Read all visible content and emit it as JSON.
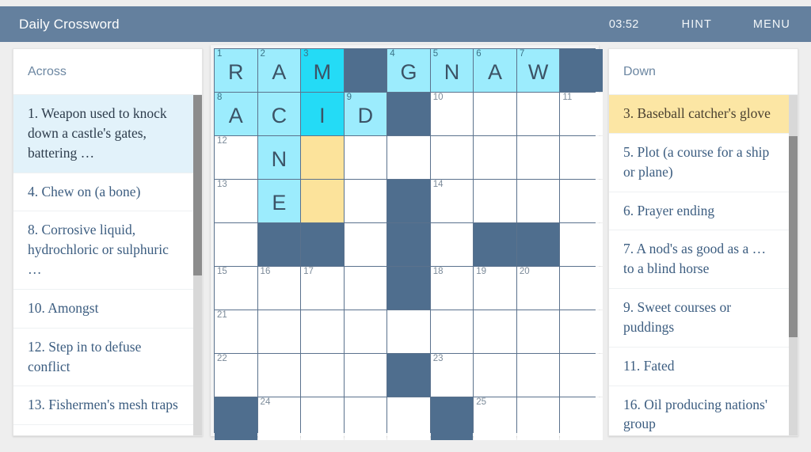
{
  "header": {
    "title": "Daily Crossword",
    "timer": "03:52",
    "hint_label": "HINT",
    "menu_label": "MENU",
    "bg_color": "#64809e",
    "text_color": "#ffffff"
  },
  "colors": {
    "page_bg": "#eeeeee",
    "panel_bg": "#ffffff",
    "block_cell": "#4f6e8e",
    "lit_cell": "#9cecfd",
    "active_cell": "#24dbf6",
    "highlight_cell": "#fce39b",
    "across_selected_bg": "#e2f2fa",
    "down_selected_bg": "#fce6a4",
    "clue_text": "#3c5d80",
    "grid_line": "#5b728d",
    "scrollbar_thumb": "#8c8c8c",
    "scrollbar_track": "#d8d8d8"
  },
  "across": {
    "heading": "Across",
    "clues": [
      {
        "number": "1",
        "text": "1. Weapon used to knock down a castle's gates, battering …",
        "selected": true
      },
      {
        "number": "4",
        "text": "4. Chew on (a bone)",
        "selected": false
      },
      {
        "number": "8",
        "text": "8. Corrosive liquid, hydrochloric or sulphuric …",
        "selected": false
      },
      {
        "number": "10",
        "text": "10. Amongst",
        "selected": false
      },
      {
        "number": "12",
        "text": "12. Step in to defuse conflict",
        "selected": false
      },
      {
        "number": "13",
        "text": "13. Fishermen's mesh traps",
        "selected": false
      }
    ]
  },
  "down": {
    "heading": "Down",
    "clues": [
      {
        "number": "3",
        "text": "3. Baseball catcher's glove",
        "selected": true
      },
      {
        "number": "5",
        "text": "5. Plot (a course for a ship or plane)",
        "selected": false
      },
      {
        "number": "6",
        "text": "6. Prayer ending",
        "selected": false
      },
      {
        "number": "7",
        "text": "7. A nod's as good as a … to a blind horse",
        "selected": false
      },
      {
        "number": "9",
        "text": "9. Sweet courses or puddings",
        "selected": false
      },
      {
        "number": "11",
        "text": "11. Fated",
        "selected": false
      },
      {
        "number": "16",
        "text": "16. Oil producing nations' group",
        "selected": false
      }
    ]
  },
  "grid": {
    "cols": 9,
    "rows": 9,
    "cells": [
      [
        {
          "s": "lit",
          "n": "1",
          "l": "R"
        },
        {
          "s": "lit",
          "n": "2",
          "l": "A"
        },
        {
          "s": "active",
          "n": "3",
          "l": "M"
        },
        {
          "s": "block",
          "n": "",
          "l": ""
        },
        {
          "s": "lit",
          "n": "4",
          "l": "G"
        },
        {
          "s": "lit",
          "n": "5",
          "l": "N"
        },
        {
          "s": "lit",
          "n": "6",
          "l": "A"
        },
        {
          "s": "lit",
          "n": "7",
          "l": "W"
        },
        {
          "s": "block",
          "n": "",
          "l": ""
        }
      ],
      [
        {
          "s": "lit",
          "n": "8",
          "l": "A"
        },
        {
          "s": "lit",
          "n": "",
          "l": "C"
        },
        {
          "s": "active",
          "n": "",
          "l": "I"
        },
        {
          "s": "lit",
          "n": "9",
          "l": "D"
        },
        {
          "s": "block",
          "n": "",
          "l": ""
        },
        {
          "s": "empty",
          "n": "10",
          "l": ""
        },
        {
          "s": "empty",
          "n": "",
          "l": ""
        },
        {
          "s": "empty",
          "n": "",
          "l": ""
        },
        {
          "s": "empty",
          "n": "11",
          "l": ""
        }
      ],
      [
        {
          "s": "empty",
          "n": "12",
          "l": ""
        },
        {
          "s": "lit",
          "n": "",
          "l": "N"
        },
        {
          "s": "hl",
          "n": "",
          "l": ""
        },
        {
          "s": "empty",
          "n": "",
          "l": ""
        },
        {
          "s": "empty",
          "n": "",
          "l": ""
        },
        {
          "s": "empty",
          "n": "",
          "l": ""
        },
        {
          "s": "empty",
          "n": "",
          "l": ""
        },
        {
          "s": "empty",
          "n": "",
          "l": ""
        },
        {
          "s": "empty",
          "n": "",
          "l": ""
        }
      ],
      [
        {
          "s": "empty",
          "n": "13",
          "l": ""
        },
        {
          "s": "lit",
          "n": "",
          "l": "E"
        },
        {
          "s": "hl",
          "n": "",
          "l": ""
        },
        {
          "s": "empty",
          "n": "",
          "l": ""
        },
        {
          "s": "block",
          "n": "",
          "l": ""
        },
        {
          "s": "empty",
          "n": "14",
          "l": ""
        },
        {
          "s": "empty",
          "n": "",
          "l": ""
        },
        {
          "s": "empty",
          "n": "",
          "l": ""
        },
        {
          "s": "empty",
          "n": "",
          "l": ""
        }
      ],
      [
        {
          "s": "empty",
          "n": "",
          "l": ""
        },
        {
          "s": "block",
          "n": "",
          "l": ""
        },
        {
          "s": "block",
          "n": "",
          "l": ""
        },
        {
          "s": "empty",
          "n": "",
          "l": ""
        },
        {
          "s": "block",
          "n": "",
          "l": ""
        },
        {
          "s": "empty",
          "n": "",
          "l": ""
        },
        {
          "s": "block",
          "n": "",
          "l": ""
        },
        {
          "s": "block",
          "n": "",
          "l": ""
        },
        {
          "s": "empty",
          "n": "",
          "l": ""
        }
      ],
      [
        {
          "s": "empty",
          "n": "15",
          "l": ""
        },
        {
          "s": "empty",
          "n": "16",
          "l": ""
        },
        {
          "s": "empty",
          "n": "17",
          "l": ""
        },
        {
          "s": "empty",
          "n": "",
          "l": ""
        },
        {
          "s": "block",
          "n": "",
          "l": ""
        },
        {
          "s": "empty",
          "n": "18",
          "l": ""
        },
        {
          "s": "empty",
          "n": "19",
          "l": ""
        },
        {
          "s": "empty",
          "n": "20",
          "l": ""
        },
        {
          "s": "empty",
          "n": "",
          "l": ""
        }
      ],
      [
        {
          "s": "empty",
          "n": "21",
          "l": ""
        },
        {
          "s": "empty",
          "n": "",
          "l": ""
        },
        {
          "s": "empty",
          "n": "",
          "l": ""
        },
        {
          "s": "empty",
          "n": "",
          "l": ""
        },
        {
          "s": "empty",
          "n": "",
          "l": ""
        },
        {
          "s": "empty",
          "n": "",
          "l": ""
        },
        {
          "s": "empty",
          "n": "",
          "l": ""
        },
        {
          "s": "empty",
          "n": "",
          "l": ""
        },
        {
          "s": "empty",
          "n": "",
          "l": ""
        }
      ],
      [
        {
          "s": "empty",
          "n": "22",
          "l": ""
        },
        {
          "s": "empty",
          "n": "",
          "l": ""
        },
        {
          "s": "empty",
          "n": "",
          "l": ""
        },
        {
          "s": "empty",
          "n": "",
          "l": ""
        },
        {
          "s": "block",
          "n": "",
          "l": ""
        },
        {
          "s": "empty",
          "n": "23",
          "l": ""
        },
        {
          "s": "empty",
          "n": "",
          "l": ""
        },
        {
          "s": "empty",
          "n": "",
          "l": ""
        },
        {
          "s": "empty",
          "n": "",
          "l": ""
        }
      ],
      [
        {
          "s": "block",
          "n": "",
          "l": ""
        },
        {
          "s": "empty",
          "n": "24",
          "l": ""
        },
        {
          "s": "empty",
          "n": "",
          "l": ""
        },
        {
          "s": "empty",
          "n": "",
          "l": ""
        },
        {
          "s": "empty",
          "n": "",
          "l": ""
        },
        {
          "s": "block",
          "n": "",
          "l": ""
        },
        {
          "s": "empty",
          "n": "25",
          "l": ""
        },
        {
          "s": "empty",
          "n": "",
          "l": ""
        },
        {
          "s": "empty",
          "n": "",
          "l": ""
        }
      ]
    ]
  }
}
